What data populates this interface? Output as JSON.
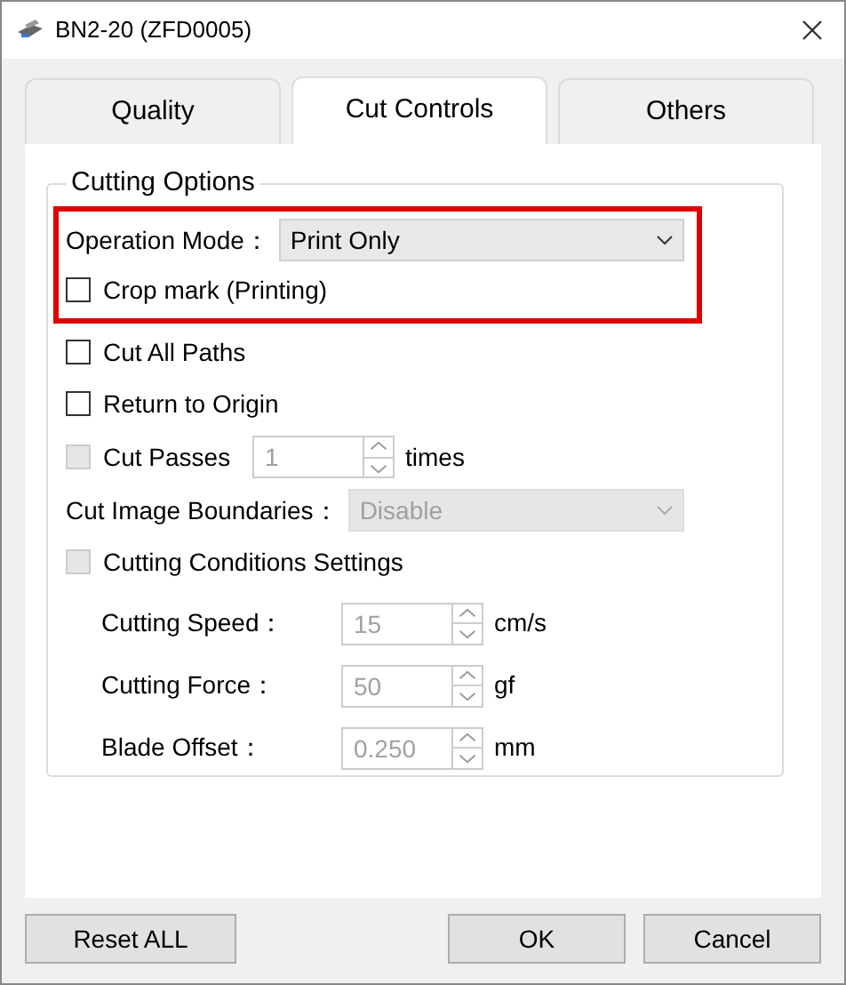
{
  "window": {
    "title": "BN2-20 (ZFD0005)"
  },
  "tabs": [
    {
      "label": "Quality",
      "selected": false
    },
    {
      "label": "Cut Controls",
      "selected": true
    },
    {
      "label": "Others",
      "selected": false
    }
  ],
  "group": {
    "title": "Cutting Options",
    "highlighted_options": [
      {
        "kind": "select",
        "label": "Operation Mode：",
        "value": "Print Only",
        "disabled": false
      },
      {
        "kind": "checkbox",
        "label": "Crop mark (Printing)",
        "checked": false,
        "disabled": false
      }
    ],
    "options": [
      {
        "kind": "checkbox",
        "label": "Cut All Paths",
        "checked": false,
        "disabled": false
      },
      {
        "kind": "checkbox",
        "label": "Return to Origin",
        "checked": false,
        "disabled": false
      },
      {
        "kind": "passes",
        "label": "Cut Passes",
        "checked": false,
        "disabled": true,
        "value": "1",
        "unit": "times"
      },
      {
        "kind": "select",
        "label": "Cut Image Boundaries：",
        "value": "Disable",
        "disabled": true
      },
      {
        "kind": "checkbox",
        "label": "Cutting Conditions Settings",
        "checked": false,
        "disabled": true,
        "children": [
          {
            "kind": "spinner",
            "label": "Cutting Speed：",
            "value": "15",
            "unit": "cm/s",
            "disabled": true
          },
          {
            "kind": "spinner",
            "label": "Cutting Force：",
            "value": "50",
            "unit": "gf",
            "disabled": true
          },
          {
            "kind": "spinner",
            "label": "Blade Offset：",
            "value": "0.250",
            "unit": "mm",
            "disabled": true
          }
        ]
      }
    ]
  },
  "buttons": [
    {
      "label": "Reset ALL"
    },
    {
      "label": "OK"
    },
    {
      "label": "Cancel"
    }
  ]
}
